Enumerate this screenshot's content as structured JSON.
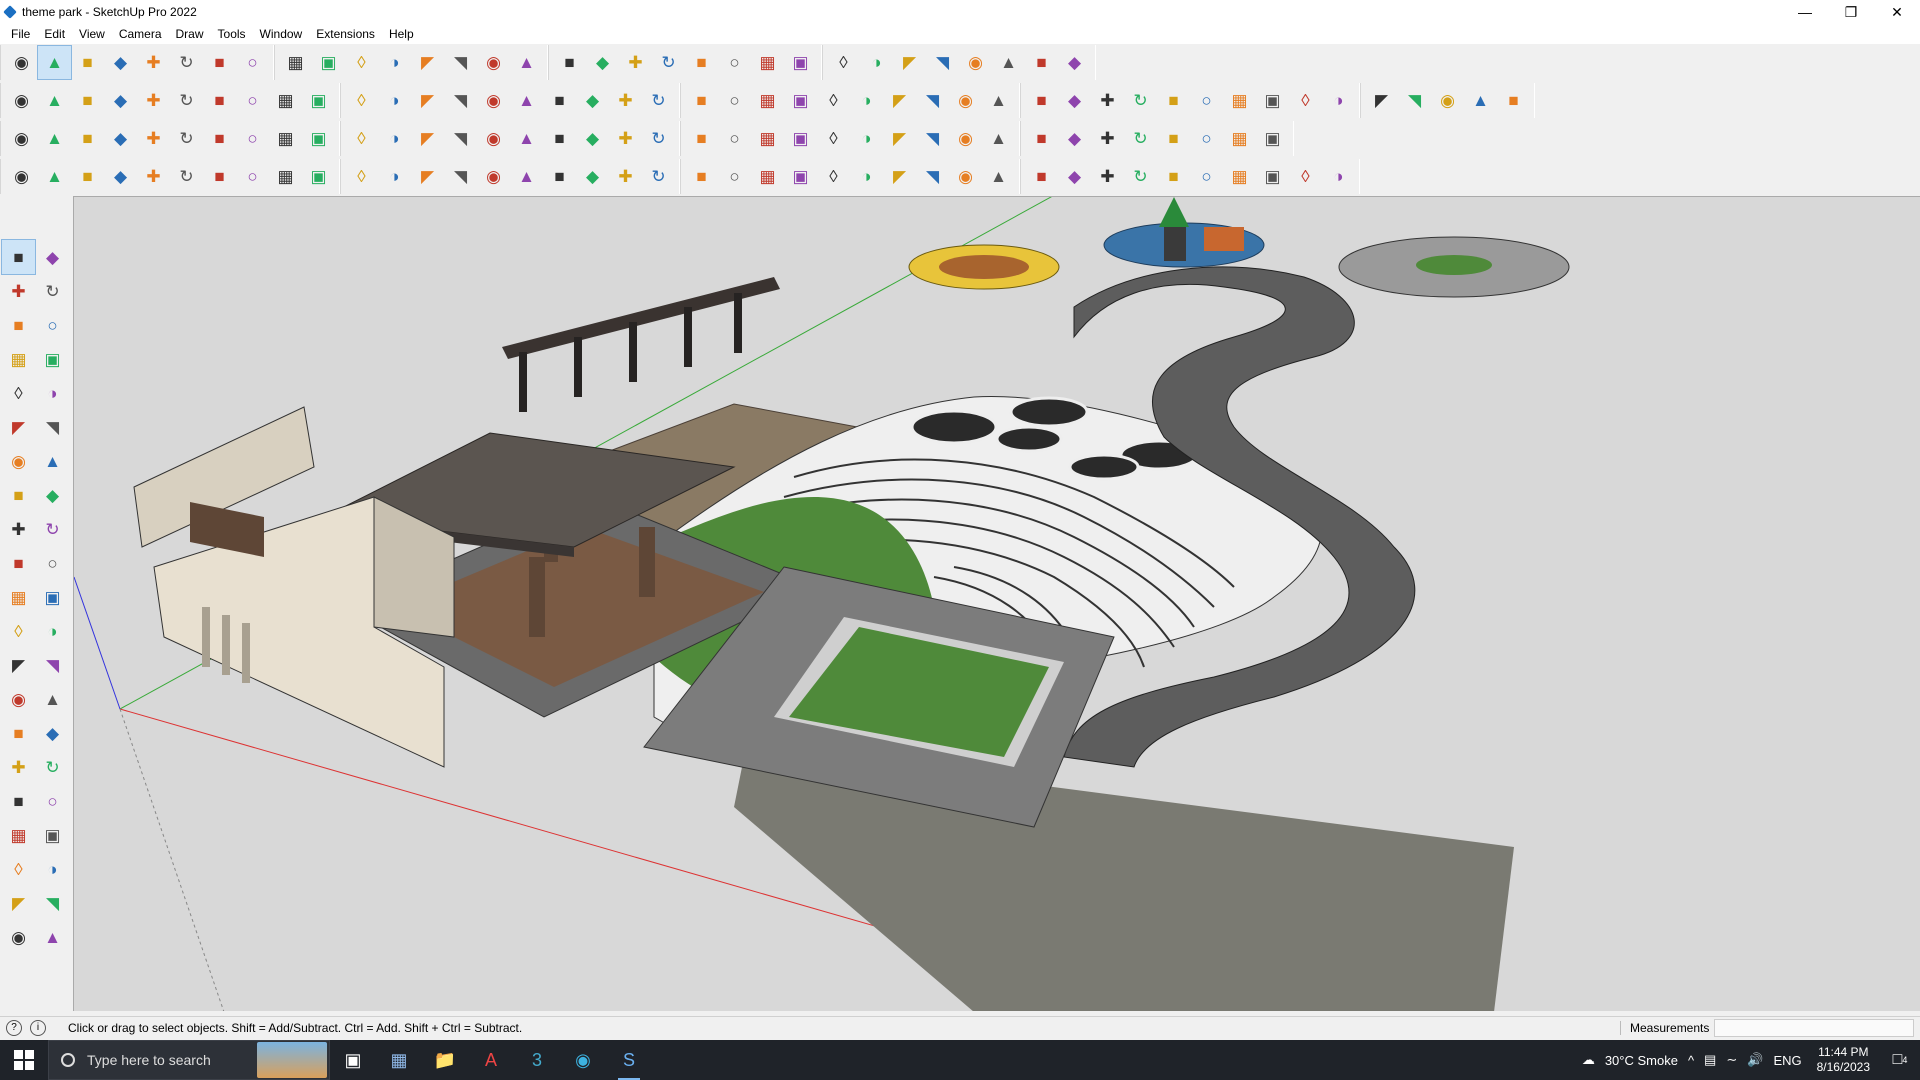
{
  "window": {
    "title": "theme park - SketchUp Pro 2022",
    "controls": [
      "minimize-icon",
      "restore-icon",
      "close-icon"
    ]
  },
  "menu": [
    "File",
    "Edit",
    "View",
    "Camera",
    "Draw",
    "Tools",
    "Window",
    "Extensions",
    "Help"
  ],
  "toolbars": {
    "row1": [
      "zoom-extents-icon",
      "select-icon",
      "eraser-icon",
      "line-icon",
      "arc-icon",
      "rectangle-icon",
      "push-pull-icon",
      "follow-me-icon",
      "move-icon",
      "rotate-icon",
      "scale-icon",
      "tape-measure-icon",
      "text-icon",
      "paint-bucket-icon",
      "orbit-icon",
      "pan-icon",
      "zoom-icon",
      "zoom-window-icon",
      "components-icon",
      "materials-icon",
      "styles-icon",
      "layers-icon",
      "profile-icon",
      "warehouse-icon",
      "extension-icon",
      "export-icon",
      "sort-icon",
      "arrows-icon",
      "transform-icon",
      "undo-icon",
      "redo-icon",
      "plugin-icon"
    ],
    "row2": [
      "iso-view-icon",
      "top-view-icon",
      "front-view-icon",
      "cube-red-icon",
      "cube-blue-icon",
      "cube-red2-icon",
      "cube-green-icon",
      "cube-orange-icon",
      "cube-orange2-icon",
      "cube-pink-icon",
      "curve-icon",
      "section-plane-icon",
      "section-display-icon",
      "section-cut-icon",
      "sandbox-icon",
      "terrain-icon",
      "house1-icon",
      "house2-icon",
      "house3-icon",
      "house4-icon",
      "house5-icon",
      "house6-icon",
      "formula-icon",
      "pin-icon",
      "pencil-icon",
      "shape1-icon",
      "shape2-icon",
      "shape3-icon",
      "shape4-icon",
      "shape5-icon",
      "shape6-icon",
      "shape7-icon",
      "shape8-icon",
      "shape9-icon",
      "shape10-icon",
      "shape11-icon",
      "paint-red-icon",
      "paint-pink-icon",
      "solid1-icon",
      "solid2-icon",
      "solid3-icon",
      "solid4-icon",
      "solid5-icon",
      "solid6-icon",
      "solid7-icon"
    ],
    "row3": [
      "plane-blue-icon",
      "plane-blue2-icon",
      "plane-yellow-icon",
      "text-tool-icon",
      "face-red-icon",
      "layer-icon",
      "loop-icon",
      "box-red-icon",
      "grid-icon",
      "panel-icon",
      "wood-icon",
      "link-icon",
      "bend-icon",
      "spline-icon",
      "cross-red-icon",
      "cross-green-icon",
      "cross-blue-icon",
      "cone-icon",
      "tree-icon",
      "warning-icon",
      "lasso-icon",
      "lasso2-icon",
      "lasso3-icon",
      "move-arrows-icon",
      "bucket-icon",
      "magnet-icon",
      "fix-icon",
      "plugin2-icon",
      "plugin3-icon",
      "gem-icon",
      "gift-icon",
      "frame-icon",
      "grid-orange-icon",
      "grid-orange2-icon",
      "grid-orange3-icon",
      "dots-icon",
      "curve2-icon",
      "qr-icon"
    ],
    "row4": [
      "path1-icon",
      "path2-icon",
      "car-icon",
      "shape-dark-icon",
      "box-wire-icon",
      "cube-wire-icon",
      "twist-icon",
      "sphere-icon",
      "helmet-icon",
      "swirl-icon",
      "corner-icon",
      "corner2-icon",
      "line-red-icon",
      "curve-red-icon",
      "building-icon",
      "sail-icon",
      "fence-icon",
      "fence2-icon",
      "fence3-icon",
      "leaf-icon",
      "flag-icon",
      "stair-icon",
      "stair2-icon",
      "stair3-icon",
      "stair4-icon",
      "stair5-icon",
      "roof1-icon",
      "roof2-icon",
      "roof3-icon",
      "roof4-icon",
      "roof5-icon",
      "roof6-icon",
      "roof7-icon",
      "roof8-icon",
      "roof9-icon",
      "roof10-icon",
      "roof11-icon",
      "roof12-icon",
      "roof13-icon",
      "roof14-icon"
    ]
  },
  "left_tools": [
    "select-tool-icon",
    "orbit-tool-icon",
    "paint-tool-icon",
    "eraser-tool-icon",
    "component-tool-icon",
    "tag-tool-icon",
    "line-tool-icon",
    "freehand-tool-icon",
    "rectangle-tool-icon",
    "rotated-rectangle-icon",
    "circle-tool-icon",
    "polygon-tool-icon",
    "arc-tool-icon",
    "two-point-arc-icon",
    "pie-tool-icon",
    "three-point-arc-icon",
    "move-tool-icon",
    "push-pull-tool-icon",
    "rotate-tool-icon",
    "follow-me-tool-icon",
    "scale-tool-icon",
    "offset-tool-icon",
    "tape-tool-icon",
    "dimension-tool-icon",
    "protractor-tool-icon",
    "text-tool-icon",
    "axes-tool-icon",
    "3d-text-tool-icon",
    "orbit2-tool-icon",
    "pan-tool-icon",
    "zoom-tool-icon",
    "zoom-window-tool-icon",
    "zoom-extents-tool-icon",
    "previous-view-icon",
    "position-camera-icon",
    "look-around-icon",
    "walk-tool-icon",
    "section-tool-icon",
    "components2-icon",
    "materials2-icon",
    "styles2-icon",
    "layers2-icon"
  ],
  "status": {
    "hint": "Click or drag to select objects. Shift = Add/Subtract. Ctrl = Add. Shift + Ctrl = Subtract.",
    "measurements_label": "Measurements",
    "measurements_value": ""
  },
  "taskbar": {
    "search_placeholder": "Type here to search",
    "apps": [
      "task-view-icon",
      "calculator-icon",
      "file-explorer-icon",
      "acrobat-icon",
      "3dsmax-icon",
      "edge-icon",
      "sketchup-icon"
    ],
    "weather": "30°C  Smoke",
    "lang": "ENG",
    "time": "11:44 PM",
    "date": "8/16/2023",
    "notifications": "4"
  },
  "colors": {
    "sky": "#d8d8d8",
    "grass": "#4f8a3a",
    "deck": "#8a7a64",
    "pavement": "#7c7c7c",
    "roof": "#5b5550",
    "wall": "#e8e0d0"
  }
}
